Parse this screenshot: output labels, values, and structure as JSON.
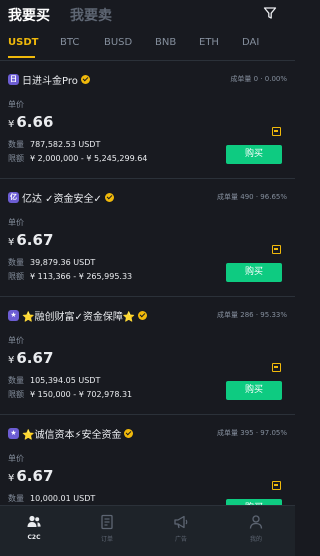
{
  "header": {
    "tab_buy": "我要买",
    "tab_sell": "我要卖"
  },
  "coins": [
    "USDT",
    "BTC",
    "BUSD",
    "BNB",
    "ETH",
    "DAI"
  ],
  "labels": {
    "unit_price": "单价",
    "quantity": "数量",
    "limit": "限额",
    "buy_button": "购买"
  },
  "ads": [
    {
      "avatar": "日",
      "name": "日进斗金Pro",
      "stats": "成单量 0 · 0.00%",
      "price_currency": "¥",
      "price": "6.66",
      "quantity": "787,582.53 USDT",
      "limit": "¥ 2,000,000 - ¥ 5,245,299.64"
    },
    {
      "avatar": "亿",
      "name": "亿达 ✓资金安全✓",
      "stats": "成单量 490 · 96.65%",
      "price_currency": "¥",
      "price": "6.67",
      "quantity": "39,879.36 USDT",
      "limit": "¥ 113,366 - ¥ 265,995.33"
    },
    {
      "avatar": "★",
      "name": "⭐融创财富✓资金保障⭐",
      "stats": "成单量 286 · 95.33%",
      "price_currency": "¥",
      "price": "6.67",
      "quantity": "105,394.05 USDT",
      "limit": "¥ 150,000 - ¥ 702,978.31"
    },
    {
      "avatar": "★",
      "name": "⭐诚信资本⚡安全资金",
      "stats": "成单量 395 · 97.05%",
      "price_currency": "¥",
      "price": "6.67",
      "quantity": "10,000.01 USDT",
      "limit": ""
    }
  ],
  "nav": {
    "c2c": "C2C",
    "orders": "订单",
    "ads": "广告",
    "profile": "我的"
  },
  "colors": {
    "accent": "#f0b90b",
    "buy": "#0ecb81",
    "background": "#181a20"
  }
}
